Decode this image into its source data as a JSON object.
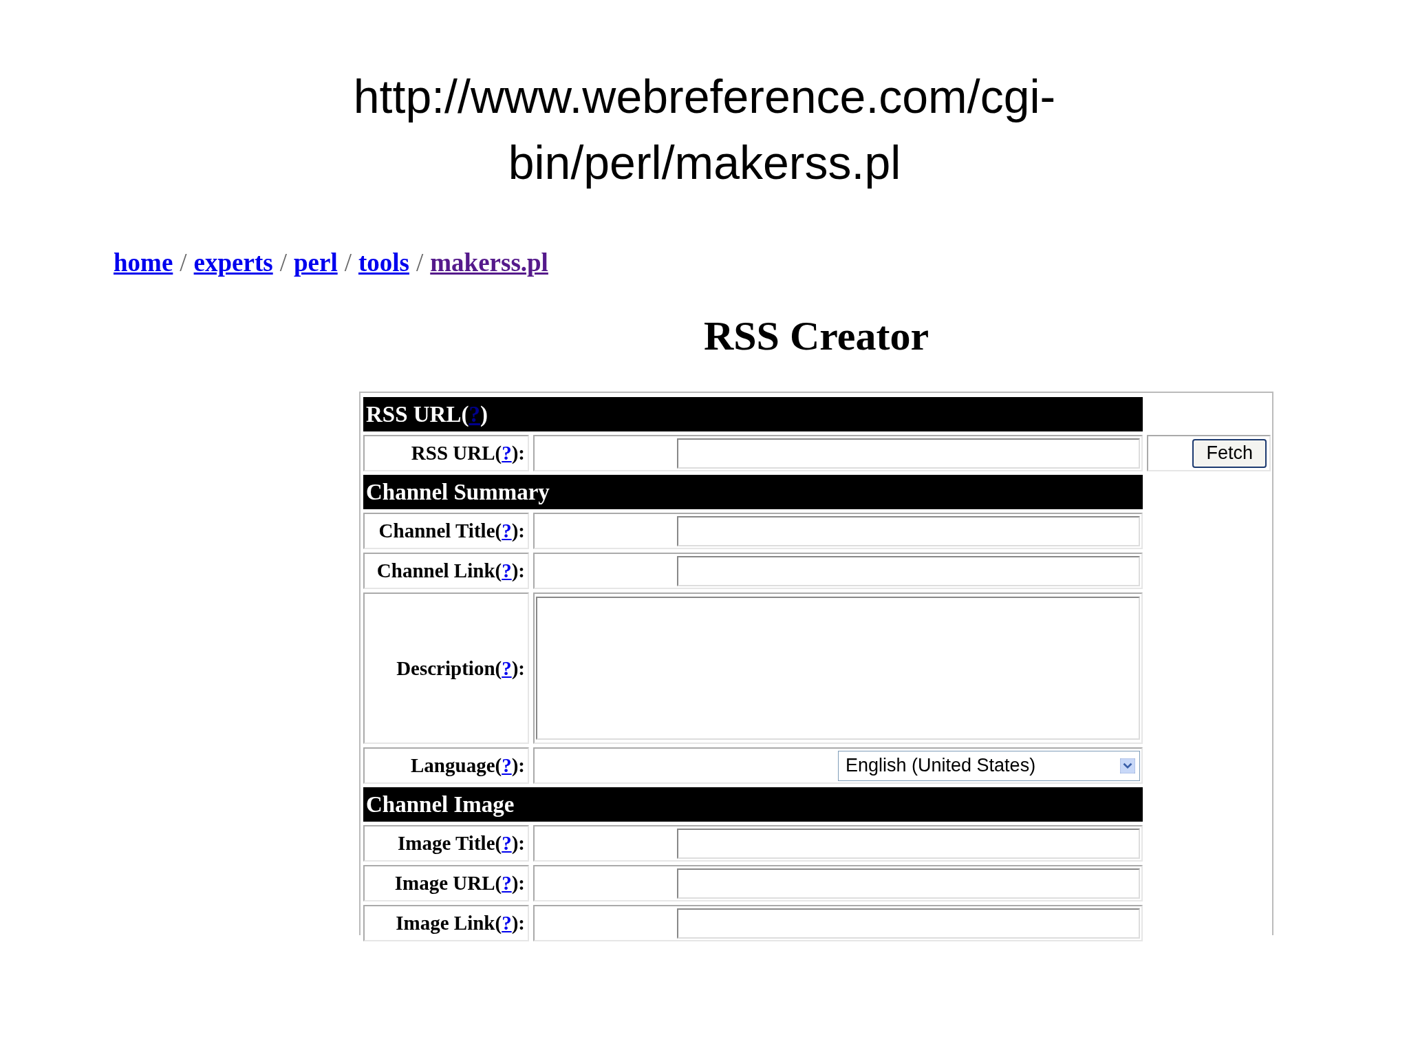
{
  "slide_title": "http://www.webreference.com/cgi-bin/perl/makerss.pl",
  "breadcrumb": [
    {
      "label": "home",
      "visited": false,
      "separator": "/"
    },
    {
      "label": "experts",
      "visited": false,
      "separator": "/"
    },
    {
      "label": "perl",
      "visited": false,
      "separator": "/"
    },
    {
      "label": "tools",
      "visited": false,
      "separator": "/"
    },
    {
      "label": "makerss.pl",
      "visited": true
    }
  ],
  "heading": "RSS Creator",
  "form_rows": [
    {
      "kind": "section",
      "label": "RSS URL(",
      "help": "?",
      "label_end": ")"
    },
    {
      "kind": "text",
      "label": "RSS URL(",
      "help": "?",
      "label_end": "):",
      "button": "Fetch"
    },
    {
      "kind": "section",
      "label": "Channel Summary"
    },
    {
      "kind": "text",
      "label": "Channel Title(",
      "help": "?",
      "label_end": "):"
    },
    {
      "kind": "text",
      "label": "Channel Link(",
      "help": "?",
      "label_end": "):"
    },
    {
      "kind": "textarea",
      "label": "Description(",
      "help": "?",
      "label_end": "):"
    },
    {
      "kind": "select",
      "label": "Language(",
      "help": "?",
      "label_end": "):",
      "value": "English (United States)"
    },
    {
      "kind": "section",
      "label": "Channel Image"
    },
    {
      "kind": "text",
      "label": "Image Title(",
      "help": "?",
      "label_end": "):"
    },
    {
      "kind": "text",
      "label": "Image URL(",
      "help": "?",
      "label_end": "):"
    },
    {
      "kind": "text",
      "label": "Image Link(",
      "help": "?",
      "label_end": "):"
    }
  ]
}
